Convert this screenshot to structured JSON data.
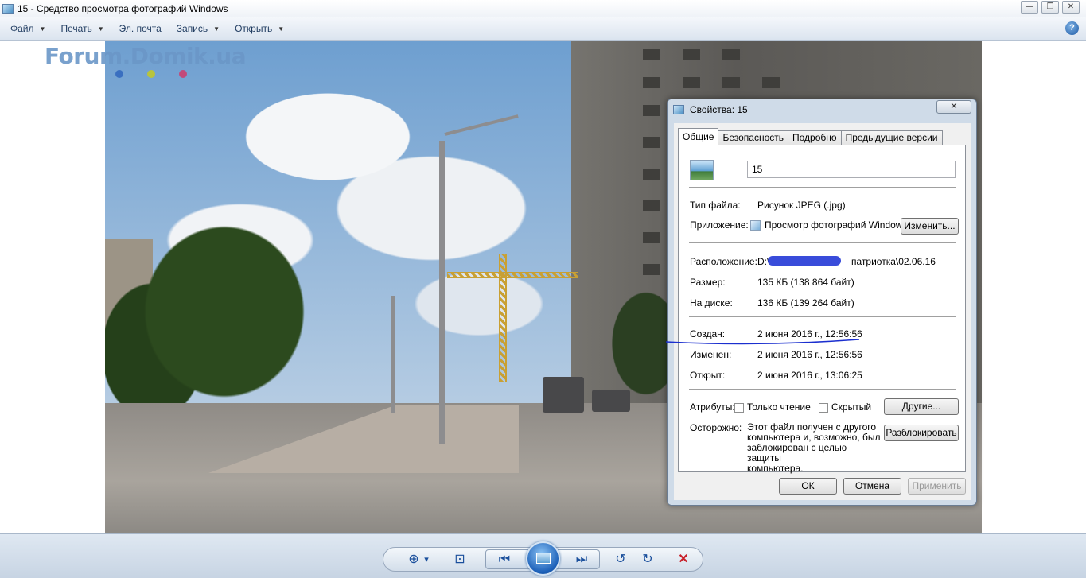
{
  "window": {
    "title": "15 - Средство просмотра фотографий Windows",
    "controls": {
      "minimize": "—",
      "restore": "❐",
      "close": "✕"
    }
  },
  "menu": {
    "items": [
      {
        "label": "Файл"
      },
      {
        "label": "Печать"
      },
      {
        "label": "Эл. почта"
      },
      {
        "label": "Запись"
      },
      {
        "label": "Открыть"
      }
    ],
    "help": "?"
  },
  "watermark": {
    "text": "Forum.Domik.ua",
    "dot_colors": [
      "#3a6fc0",
      "#b8c43c",
      "#c24a7a"
    ]
  },
  "dialog": {
    "title": "Свойства: 15",
    "close_glyph": "✕",
    "tabs": [
      {
        "label": "Общие",
        "active": true
      },
      {
        "label": "Безопасность",
        "active": false
      },
      {
        "label": "Подробно",
        "active": false
      },
      {
        "label": "Предыдущие версии",
        "active": false
      }
    ],
    "file_name": "15",
    "file_type": {
      "label": "Тип файла:",
      "value": "Рисунок JPEG (.jpg)"
    },
    "application": {
      "label": "Приложение:",
      "value": "Просмотр фотографий Windows",
      "change_button": "Изменить..."
    },
    "location": {
      "label": "Расположение:",
      "value_start": "D:\\",
      "value_end": "патриотка\\02.06.16"
    },
    "size": {
      "label": "Размер:",
      "value": "135 КБ (138 864 байт)"
    },
    "on_disk": {
      "label": "На диске:",
      "value": "136 КБ (139 264 байт)"
    },
    "created": {
      "label": "Создан:",
      "value": "2 июня 2016 г., 12:56:56"
    },
    "modified": {
      "label": "Изменен:",
      "value": "2 июня 2016 г., 12:56:56"
    },
    "opened": {
      "label": "Открыт:",
      "value": "2 июня 2016 г., 13:06:25"
    },
    "attributes": {
      "label": "Атрибуты:",
      "readonly": "Только чтение",
      "hidden": "Скрытый",
      "other_button": "Другие..."
    },
    "security": {
      "label": "Осторожно:",
      "text_lines": [
        "Этот файл получен с другого",
        "компьютера и, возможно, был",
        "заблокирован с целью защиты",
        "компьютера."
      ],
      "unblock_button": "Разблокировать"
    },
    "buttons": {
      "ok": "ОК",
      "cancel": "Отмена",
      "apply": "Применить"
    }
  },
  "toolbar": {
    "zoom_icon": "⊕",
    "zoom_arrow": "▾",
    "fit_icon": "⊡",
    "prev_icon": "⏮",
    "next_icon": "⏭",
    "rotate_left_icon": "↺",
    "rotate_right_icon": "↻",
    "delete_icon": "✕"
  }
}
